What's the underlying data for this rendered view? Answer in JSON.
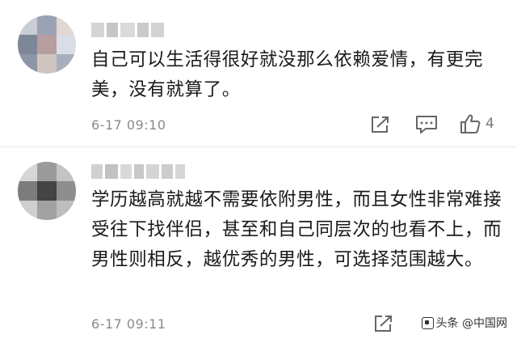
{
  "comments": [
    {
      "avatar": {
        "colors": [
          "#c8cdd6",
          "#9aa3b4",
          "#e2d7d3",
          "#7d8797",
          "#b89e9e",
          "#d9dee6",
          "#8d96a5",
          "#cfc4bf",
          "#a6afbd"
        ]
      },
      "username": "",
      "text": "自己可以生活得很好就没那么依赖爱情，有更完美，没有就算了。",
      "time": "6-17 09:10",
      "likes": "4"
    },
    {
      "avatar": {
        "colors": [
          "#d6d6d6",
          "#9a9a9a",
          "#c4c4c4",
          "#7c7c7c",
          "#444444",
          "#8e8e8e",
          "#cfcfcf",
          "#a2a2a2",
          "#bdbdbd"
        ]
      },
      "username": "",
      "text": "学历越高就越不需要依附男性，而且女性非常难接受往下找伴侣，甚至和自己同层次的也看不上，而男性则相反，越优秀的男性，可选择范围越大。",
      "time": "6-17 09:11",
      "likes": ""
    }
  ],
  "icons": {
    "share": "share-icon",
    "reply": "comment-icon",
    "like": "thumbs-up-icon"
  },
  "watermark": {
    "text": "头条 @中国网",
    "color": "#333333"
  }
}
